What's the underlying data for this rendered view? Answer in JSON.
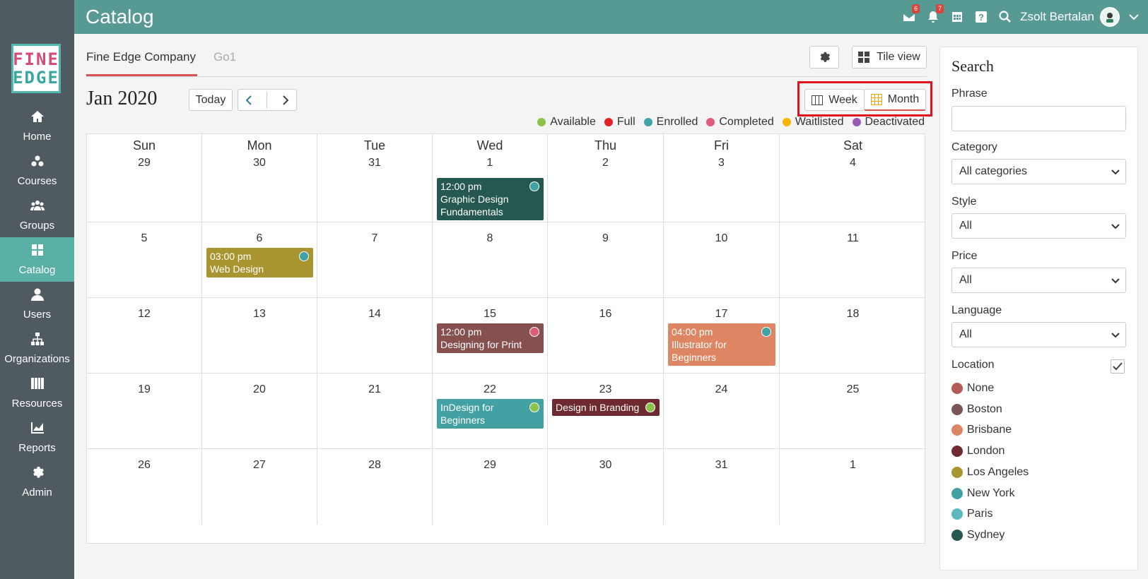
{
  "topbar": {
    "title": "Catalog",
    "messages_badge": "6",
    "notifications_badge": "7",
    "user_name": "Zsolt Bertalan"
  },
  "logo": {
    "line1": "FINE",
    "line2": "EDGE"
  },
  "sidebar": {
    "items": [
      {
        "label": "Home",
        "icon": "home-icon"
      },
      {
        "label": "Courses",
        "icon": "courses-icon"
      },
      {
        "label": "Groups",
        "icon": "groups-icon"
      },
      {
        "label": "Catalog",
        "icon": "catalog-icon",
        "active": true
      },
      {
        "label": "Users",
        "icon": "user-icon"
      },
      {
        "label": "Organizations",
        "icon": "org-icon"
      },
      {
        "label": "Resources",
        "icon": "resources-icon"
      },
      {
        "label": "Reports",
        "icon": "reports-icon"
      },
      {
        "label": "Admin",
        "icon": "gear-icon"
      }
    ]
  },
  "tabs": [
    {
      "label": "Fine Edge Company"
    },
    {
      "label": "Go1"
    }
  ],
  "toolbar": {
    "tile_view": "Tile view",
    "today": "Today",
    "week": "Week",
    "month": "Month"
  },
  "calendar": {
    "title": "Jan 2020",
    "daynames": [
      "Sun",
      "Mon",
      "Tue",
      "Wed",
      "Thu",
      "Fri",
      "Sat"
    ],
    "weeks": [
      [
        "29",
        "30",
        "31",
        "1",
        "2",
        "3",
        "4"
      ],
      [
        "5",
        "6",
        "7",
        "8",
        "9",
        "10",
        "11"
      ],
      [
        "12",
        "13",
        "14",
        "15",
        "16",
        "17",
        "18"
      ],
      [
        "19",
        "20",
        "21",
        "22",
        "23",
        "24",
        "25"
      ],
      [
        "26",
        "27",
        "28",
        "29",
        "30",
        "31",
        "1"
      ]
    ],
    "events": [
      {
        "time": "12:00 pm",
        "title": "Graphic Design Fundamentals",
        "week": 0,
        "day": 3,
        "color": "#25584f",
        "status_color": "#3fa3a6"
      },
      {
        "time": "03:00 pm",
        "title": "Web Design",
        "week": 1,
        "day": 1,
        "color": "#a99530",
        "status_color": "#3fa3a6"
      },
      {
        "time": "12:00 pm",
        "title": "Designing for Print",
        "week": 2,
        "day": 3,
        "color": "#86504f",
        "status_color": "#e05a7a"
      },
      {
        "time": "04:00 pm",
        "title": "Illustrator for Beginners",
        "week": 2,
        "day": 5,
        "color": "#de8563",
        "status_color": "#3fa3a6"
      },
      {
        "time": "",
        "title": "InDesign for Beginners",
        "week": 3,
        "day": 3,
        "color": "#43a1a4",
        "status_color": "#8bc34a"
      },
      {
        "time": "",
        "title": "Design in Branding",
        "week": 3,
        "day": 4,
        "color": "#6e2a2f",
        "status_color": "#8bc34a"
      }
    ]
  },
  "legend": [
    {
      "label": "Available",
      "color": "#8bc34a"
    },
    {
      "label": "Full",
      "color": "#e02424"
    },
    {
      "label": "Enrolled",
      "color": "#3fa3a6"
    },
    {
      "label": "Completed",
      "color": "#e05a7a"
    },
    {
      "label": "Waitlisted",
      "color": "#f7b500"
    },
    {
      "label": "Deactivated",
      "color": "#9b59b6"
    }
  ],
  "search": {
    "title": "Search",
    "phrase_label": "Phrase",
    "phrase_value": "",
    "category_label": "Category",
    "category_value": "All categories",
    "style_label": "Style",
    "style_value": "All",
    "price_label": "Price",
    "price_value": "All",
    "language_label": "Language",
    "language_value": "All",
    "location_label": "Location",
    "locations": [
      {
        "label": "None",
        "color": "#b45a56"
      },
      {
        "label": "Boston",
        "color": "#7a5657"
      },
      {
        "label": "Brisbane",
        "color": "#de8563"
      },
      {
        "label": "London",
        "color": "#6e2a2f"
      },
      {
        "label": "Los Angeles",
        "color": "#a99530"
      },
      {
        "label": "New York",
        "color": "#43a1a4"
      },
      {
        "label": "Paris",
        "color": "#5bb8c0"
      },
      {
        "label": "Sydney",
        "color": "#25584f"
      }
    ]
  }
}
